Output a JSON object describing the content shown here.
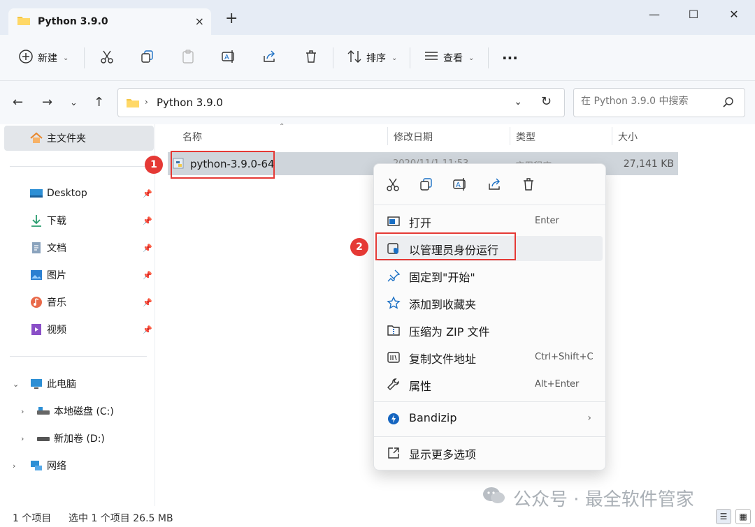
{
  "window": {
    "tab_title": "Python 3.9.0",
    "new_tab": "+",
    "tab_close": "×",
    "minimize": "—",
    "maximize": "☐",
    "close": "✕"
  },
  "toolbar": {
    "new_label": "新建",
    "sort_label": "排序",
    "view_label": "查看",
    "more_label": "···"
  },
  "address": {
    "path": "Python 3.9.0",
    "search_placeholder": "在 Python 3.9.0 中搜索"
  },
  "sidebar": {
    "home": "主文件夹",
    "quick": [
      {
        "label": "Desktop",
        "icon": "desktop-icon"
      },
      {
        "label": "下载",
        "icon": "download-icon"
      },
      {
        "label": "文档",
        "icon": "document-icon"
      },
      {
        "label": "图片",
        "icon": "pictures-icon"
      },
      {
        "label": "音乐",
        "icon": "music-icon"
      },
      {
        "label": "视频",
        "icon": "video-icon"
      }
    ],
    "this_pc": "此电脑",
    "drives": [
      "本地磁盘 (C:)",
      "新加卷 (D:)"
    ],
    "network": "网络"
  },
  "columns": {
    "name": "名称",
    "date": "修改日期",
    "type": "类型",
    "size": "大小"
  },
  "file": {
    "name": "python-3.9.0-64",
    "date": "2020/11/1 11:53",
    "type": "应用程序",
    "size": "27,141 KB"
  },
  "badges": {
    "one": "1",
    "two": "2"
  },
  "context_menu": {
    "quick_icons": [
      "cut-icon",
      "copy-icon",
      "rename-icon",
      "share-icon",
      "delete-icon"
    ],
    "items": [
      {
        "label": "打开",
        "shortcut": "Enter"
      },
      {
        "label": "以管理员身份运行",
        "shortcut": ""
      },
      {
        "label": "固定到\"开始\"",
        "shortcut": ""
      },
      {
        "label": "添加到收藏夹",
        "shortcut": ""
      },
      {
        "label": "压缩为 ZIP 文件",
        "shortcut": ""
      },
      {
        "label": "复制文件地址",
        "shortcut": "Ctrl+Shift+C"
      },
      {
        "label": "属性",
        "shortcut": "Alt+Enter"
      },
      {
        "label": "Bandizip",
        "shortcut": ""
      },
      {
        "label": "显示更多选项",
        "shortcut": ""
      }
    ]
  },
  "status": {
    "count": "1 个项目",
    "selected": "选中 1 个项目  26.5 MB"
  },
  "watermark": "公众号 · 最全软件管家",
  "colors": {
    "accent": "#0067c0",
    "highlight": "#e53935",
    "selection": "#cfd5db"
  }
}
